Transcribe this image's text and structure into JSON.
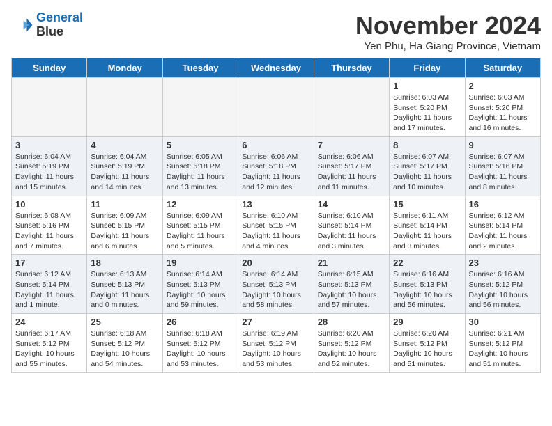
{
  "header": {
    "logo": {
      "line1": "General",
      "line2": "Blue"
    },
    "title": "November 2024",
    "location": "Yen Phu, Ha Giang Province, Vietnam"
  },
  "days_of_week": [
    "Sunday",
    "Monday",
    "Tuesday",
    "Wednesday",
    "Thursday",
    "Friday",
    "Saturday"
  ],
  "weeks": [
    [
      {
        "day": "",
        "info": ""
      },
      {
        "day": "",
        "info": ""
      },
      {
        "day": "",
        "info": ""
      },
      {
        "day": "",
        "info": ""
      },
      {
        "day": "",
        "info": ""
      },
      {
        "day": "1",
        "info": "Sunrise: 6:03 AM\nSunset: 5:20 PM\nDaylight: 11 hours and 17 minutes."
      },
      {
        "day": "2",
        "info": "Sunrise: 6:03 AM\nSunset: 5:20 PM\nDaylight: 11 hours and 16 minutes."
      }
    ],
    [
      {
        "day": "3",
        "info": "Sunrise: 6:04 AM\nSunset: 5:19 PM\nDaylight: 11 hours and 15 minutes."
      },
      {
        "day": "4",
        "info": "Sunrise: 6:04 AM\nSunset: 5:19 PM\nDaylight: 11 hours and 14 minutes."
      },
      {
        "day": "5",
        "info": "Sunrise: 6:05 AM\nSunset: 5:18 PM\nDaylight: 11 hours and 13 minutes."
      },
      {
        "day": "6",
        "info": "Sunrise: 6:06 AM\nSunset: 5:18 PM\nDaylight: 11 hours and 12 minutes."
      },
      {
        "day": "7",
        "info": "Sunrise: 6:06 AM\nSunset: 5:17 PM\nDaylight: 11 hours and 11 minutes."
      },
      {
        "day": "8",
        "info": "Sunrise: 6:07 AM\nSunset: 5:17 PM\nDaylight: 11 hours and 10 minutes."
      },
      {
        "day": "9",
        "info": "Sunrise: 6:07 AM\nSunset: 5:16 PM\nDaylight: 11 hours and 8 minutes."
      }
    ],
    [
      {
        "day": "10",
        "info": "Sunrise: 6:08 AM\nSunset: 5:16 PM\nDaylight: 11 hours and 7 minutes."
      },
      {
        "day": "11",
        "info": "Sunrise: 6:09 AM\nSunset: 5:15 PM\nDaylight: 11 hours and 6 minutes."
      },
      {
        "day": "12",
        "info": "Sunrise: 6:09 AM\nSunset: 5:15 PM\nDaylight: 11 hours and 5 minutes."
      },
      {
        "day": "13",
        "info": "Sunrise: 6:10 AM\nSunset: 5:15 PM\nDaylight: 11 hours and 4 minutes."
      },
      {
        "day": "14",
        "info": "Sunrise: 6:10 AM\nSunset: 5:14 PM\nDaylight: 11 hours and 3 minutes."
      },
      {
        "day": "15",
        "info": "Sunrise: 6:11 AM\nSunset: 5:14 PM\nDaylight: 11 hours and 3 minutes."
      },
      {
        "day": "16",
        "info": "Sunrise: 6:12 AM\nSunset: 5:14 PM\nDaylight: 11 hours and 2 minutes."
      }
    ],
    [
      {
        "day": "17",
        "info": "Sunrise: 6:12 AM\nSunset: 5:14 PM\nDaylight: 11 hours and 1 minute."
      },
      {
        "day": "18",
        "info": "Sunrise: 6:13 AM\nSunset: 5:13 PM\nDaylight: 11 hours and 0 minutes."
      },
      {
        "day": "19",
        "info": "Sunrise: 6:14 AM\nSunset: 5:13 PM\nDaylight: 10 hours and 59 minutes."
      },
      {
        "day": "20",
        "info": "Sunrise: 6:14 AM\nSunset: 5:13 PM\nDaylight: 10 hours and 58 minutes."
      },
      {
        "day": "21",
        "info": "Sunrise: 6:15 AM\nSunset: 5:13 PM\nDaylight: 10 hours and 57 minutes."
      },
      {
        "day": "22",
        "info": "Sunrise: 6:16 AM\nSunset: 5:13 PM\nDaylight: 10 hours and 56 minutes."
      },
      {
        "day": "23",
        "info": "Sunrise: 6:16 AM\nSunset: 5:12 PM\nDaylight: 10 hours and 56 minutes."
      }
    ],
    [
      {
        "day": "24",
        "info": "Sunrise: 6:17 AM\nSunset: 5:12 PM\nDaylight: 10 hours and 55 minutes."
      },
      {
        "day": "25",
        "info": "Sunrise: 6:18 AM\nSunset: 5:12 PM\nDaylight: 10 hours and 54 minutes."
      },
      {
        "day": "26",
        "info": "Sunrise: 6:18 AM\nSunset: 5:12 PM\nDaylight: 10 hours and 53 minutes."
      },
      {
        "day": "27",
        "info": "Sunrise: 6:19 AM\nSunset: 5:12 PM\nDaylight: 10 hours and 53 minutes."
      },
      {
        "day": "28",
        "info": "Sunrise: 6:20 AM\nSunset: 5:12 PM\nDaylight: 10 hours and 52 minutes."
      },
      {
        "day": "29",
        "info": "Sunrise: 6:20 AM\nSunset: 5:12 PM\nDaylight: 10 hours and 51 minutes."
      },
      {
        "day": "30",
        "info": "Sunrise: 6:21 AM\nSunset: 5:12 PM\nDaylight: 10 hours and 51 minutes."
      }
    ]
  ]
}
